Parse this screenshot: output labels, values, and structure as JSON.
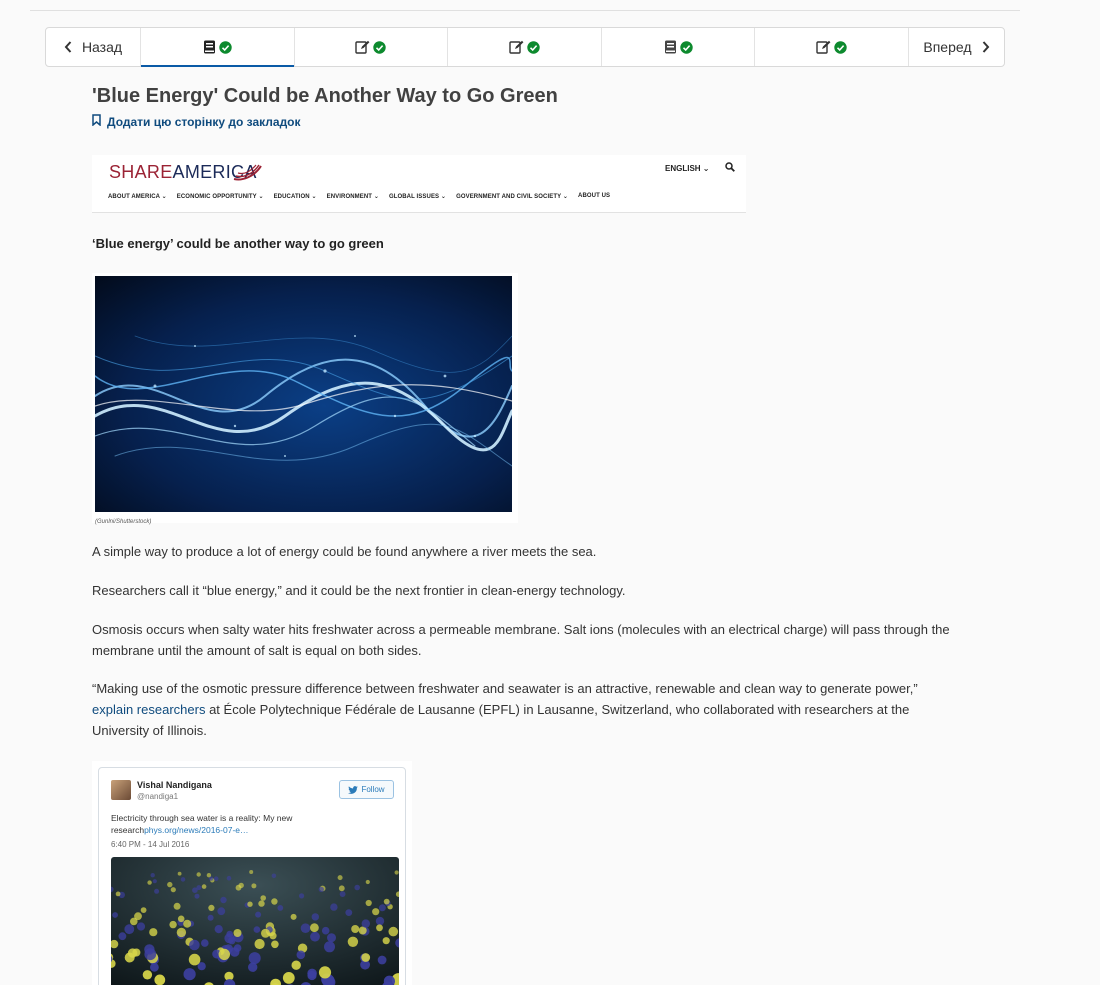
{
  "nav": {
    "prev_label": "Назад",
    "next_label": "Вперед",
    "units": [
      {
        "icon": "book-icon",
        "status": "check-icon",
        "active": true
      },
      {
        "icon": "edit-icon",
        "status": "check-icon",
        "active": false
      },
      {
        "icon": "edit-icon",
        "status": "check-icon",
        "active": false
      },
      {
        "icon": "book-icon",
        "status": "check-icon",
        "active": false
      },
      {
        "icon": "edit-icon",
        "status": "check-icon",
        "active": false
      }
    ]
  },
  "page": {
    "title": "'Blue Energy' Could be Another Way to Go Green",
    "bookmark_label": "Додати цю сторінку до закладок"
  },
  "shareamerica": {
    "logo_part1": "SHARE",
    "logo_part2": "AMERICA",
    "language": "ENGLISH",
    "menu": [
      "ABOUT AMERICA",
      "ECONOMIC OPPORTUNITY",
      "EDUCATION",
      "ENVIRONMENT",
      "GLOBAL ISSUES",
      "GOVERNMENT AND CIVIL SOCIETY",
      "ABOUT US"
    ]
  },
  "article": {
    "lead": "‘Blue energy’ could be another way to go green",
    "image_caption": "(Gunlni/Shutterstock)",
    "p1": "A simple way to produce a lot of energy could be found anywhere a river meets the sea.",
    "p2": "Researchers call it “blue energy,” and it could be the next frontier in clean-energy technology.",
    "p3": "Osmosis occurs when salty water hits freshwater across a permeable membrane. Salt ions (molecules with an electrical charge) will pass through the membrane until the amount of salt is equal on both sides.",
    "p4_before": "“Making use of the osmotic pressure difference between freshwater and seawater is an attractive, renewable and clean way to generate power,” ",
    "p4_link": "explain researchers",
    "p4_after": " at École Polytechnique Fédérale de Lausanne (EPFL) in Lausanne, Switzerland, who collaborated with researchers at the University of Illinois."
  },
  "tweet": {
    "name": "Vishal Nandigana",
    "handle": "@nandiga1",
    "follow_label": "Follow",
    "text": "Electricity through sea water is a reality: My new research",
    "link": "phys.org/news/2016-07-e…",
    "timestamp": "6:40 PM - 14 Jul 2016"
  },
  "colors": {
    "accent": "#0a5aa6",
    "check": "#0d8a2e",
    "link": "#0f4b7e",
    "brand_red": "#9b2335"
  }
}
